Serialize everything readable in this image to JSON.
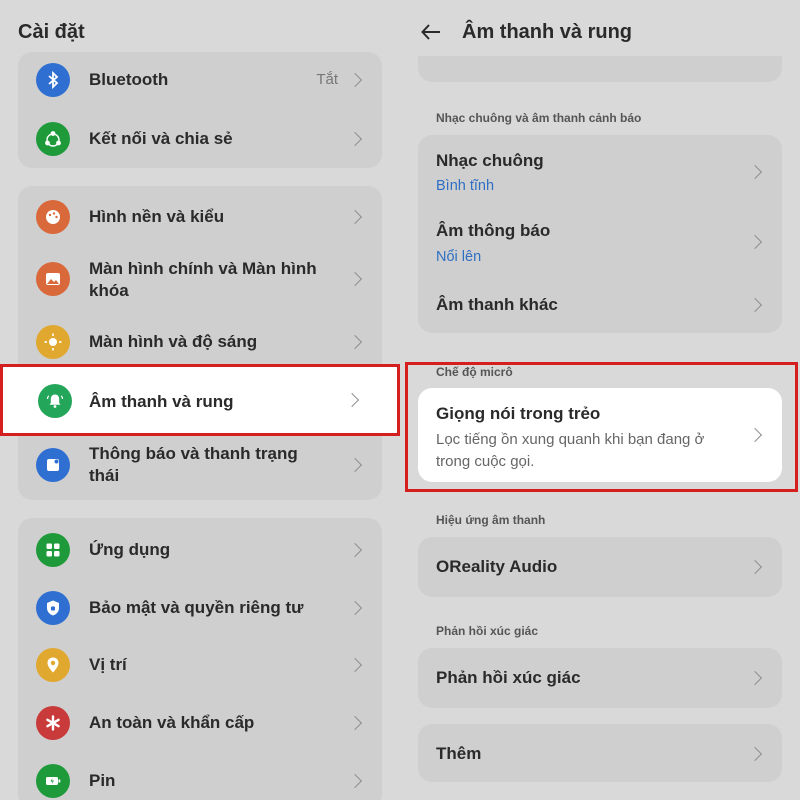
{
  "left": {
    "title": "Cài đặt",
    "group1": {
      "bluetooth": {
        "label": "Bluetooth",
        "value": "Tắt",
        "icon": "bluetooth-icon",
        "color": "#2f6fd1"
      },
      "connection": {
        "label": "Kết nối và chia sẻ",
        "icon": "share-icon",
        "color": "#1f9a3a"
      }
    },
    "group2": {
      "wallpaper": {
        "label": "Hình nền và kiểu",
        "icon": "palette-icon",
        "color": "#d9693a"
      },
      "homescreen": {
        "label_line1": "Màn hình chính và Màn hình",
        "label_line2": "khóa",
        "icon": "image-icon",
        "color": "#d9693a"
      },
      "display": {
        "label": "Màn hình và độ sáng",
        "icon": "sun-icon",
        "color": "#e0a82e"
      },
      "sound": {
        "label": "Âm thanh và rung",
        "icon": "bell-icon",
        "color": "#23a65a"
      },
      "notifications": {
        "label_line1": "Thông báo và thanh trạng",
        "label_line2": "thái",
        "icon": "notification-icon",
        "color": "#2f6fd1"
      }
    },
    "group3": {
      "apps": {
        "label": "Ứng dụng",
        "icon": "apps-icon",
        "color": "#1f9a3a"
      },
      "privacy": {
        "label": "Bảo mật và quyền riêng tư",
        "icon": "shield-icon",
        "color": "#2f6fd1"
      },
      "location": {
        "label": "Vị trí",
        "icon": "location-icon",
        "color": "#e0a82e"
      },
      "safety": {
        "label": "An toàn và khẩn cấp",
        "icon": "asterisk-icon",
        "color": "#c93a3a"
      },
      "battery": {
        "label": "Pin",
        "icon": "battery-icon",
        "color": "#1f9a3a"
      }
    }
  },
  "right": {
    "title": "Âm thanh và rung",
    "section_ringtone": "Nhạc chuông và âm thanh cảnh báo",
    "ringtone": {
      "label": "Nhạc chuông",
      "value": "Bình tĩnh"
    },
    "notification": {
      "label": "Âm thông báo",
      "value": "Nổi lên"
    },
    "other_sounds": {
      "label": "Âm thanh khác"
    },
    "section_mic": "Chế độ micrô",
    "voice": {
      "label": "Giọng nói trong trẻo",
      "desc": "Lọc tiếng ồn xung quanh khi bạn đang ở trong cuộc gọi."
    },
    "section_effects": "Hiệu ứng âm thanh",
    "oreality": {
      "label": "OReality Audio"
    },
    "section_haptics": "Phản hồi xúc giác",
    "haptics": {
      "label": "Phản hồi xúc giác"
    },
    "more": {
      "label": "Thêm"
    }
  },
  "colors": {
    "highlight": "#d51e1e",
    "link": "#2e6fc4"
  }
}
